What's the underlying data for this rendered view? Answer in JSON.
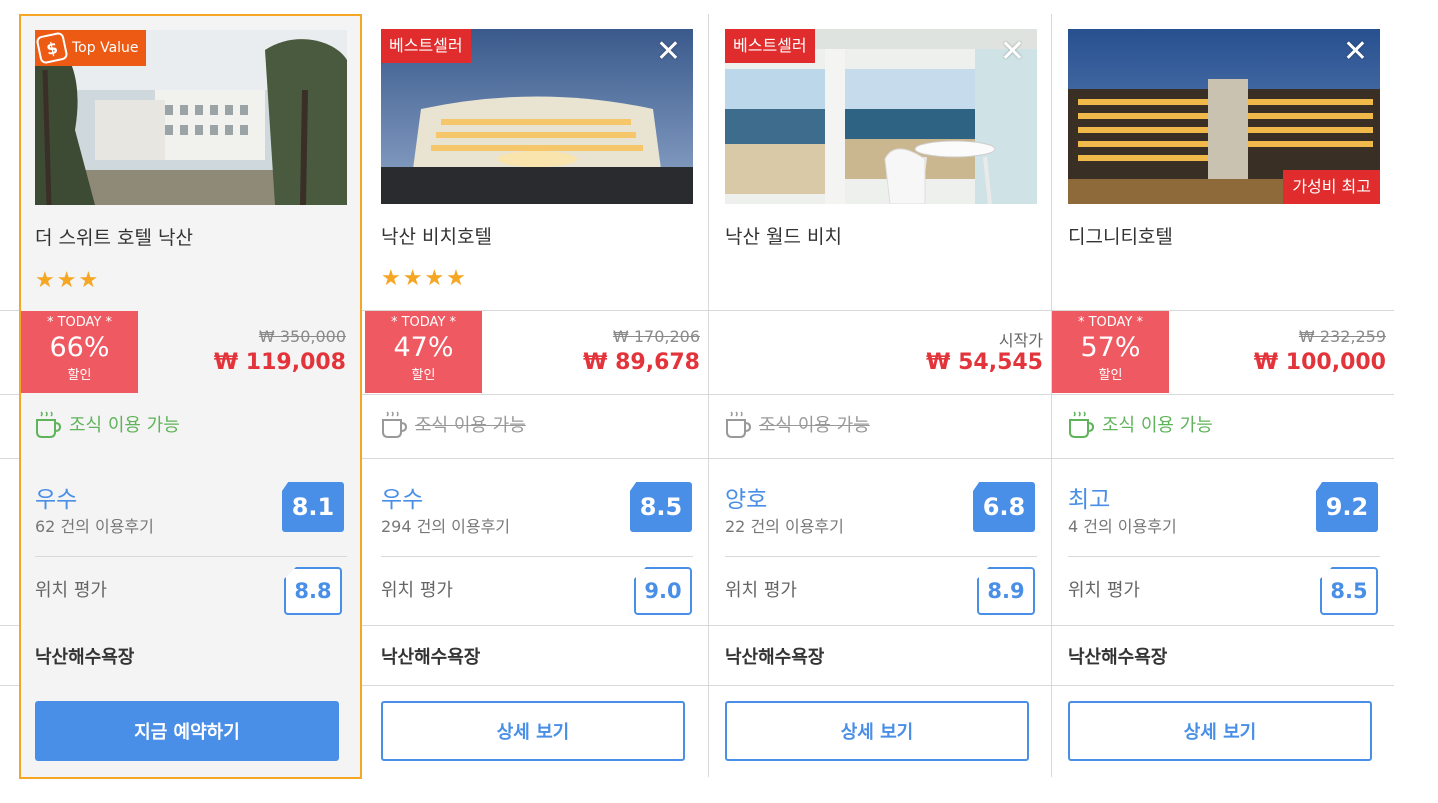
{
  "hotels": [
    {
      "name": "더 스위트 호텔 낙산",
      "top_value_label": "Top Value",
      "stars": "★★★",
      "today_label": "* TODAY *",
      "discount": "66%",
      "discount_suffix": "할인",
      "original_price": "₩ 350,000",
      "price": "₩ 119,008",
      "breakfast": "조식 이용 가능",
      "rating_word": "우수",
      "reviews": "62 건의 이용후기",
      "score": "8.1",
      "location_label": "위치 평가",
      "location_score": "8.8",
      "landmark": "낙산해수욕장",
      "button": "지금 예약하기"
    },
    {
      "name": "낙산 비치호텔",
      "badge": "베스트셀러",
      "stars": "★★★★",
      "today_label": "* TODAY *",
      "discount": "47%",
      "discount_suffix": "할인",
      "original_price": "₩ 170,206",
      "price": "₩ 89,678",
      "breakfast": "조식 이용 가능",
      "rating_word": "우수",
      "reviews": "294 건의 이용후기",
      "score": "8.5",
      "location_label": "위치 평가",
      "location_score": "9.0",
      "landmark": "낙산해수욕장",
      "button": "상세 보기"
    },
    {
      "name": "낙산 월드 비치",
      "badge": "베스트셀러",
      "start_label": "시작가",
      "price": "₩ 54,545",
      "breakfast": "조식 이용 가능",
      "rating_word": "양호",
      "reviews": "22 건의 이용후기",
      "score": "6.8",
      "location_label": "위치 평가",
      "location_score": "8.9",
      "landmark": "낙산해수욕장",
      "button": "상세 보기"
    },
    {
      "name": "디그니티호텔",
      "badge_bottom": "가성비 최고",
      "today_label": "* TODAY *",
      "discount": "57%",
      "discount_suffix": "할인",
      "original_price": "₩ 232,259",
      "price": "₩ 100,000",
      "breakfast": "조식 이용 가능",
      "rating_word": "최고",
      "reviews": "4 건의 이용후기",
      "score": "9.2",
      "location_label": "위치 평가",
      "location_score": "8.5",
      "landmark": "낙산해수욕장",
      "button": "상세 보기"
    }
  ],
  "close_icon": "close-icon",
  "colors": {
    "accent": "#4a8fe7",
    "discount": "#ef5961",
    "price": "#e2343a",
    "star": "#f5a623",
    "breakfast_yes": "#5fb35a",
    "highlight_border": "#f5a623"
  }
}
